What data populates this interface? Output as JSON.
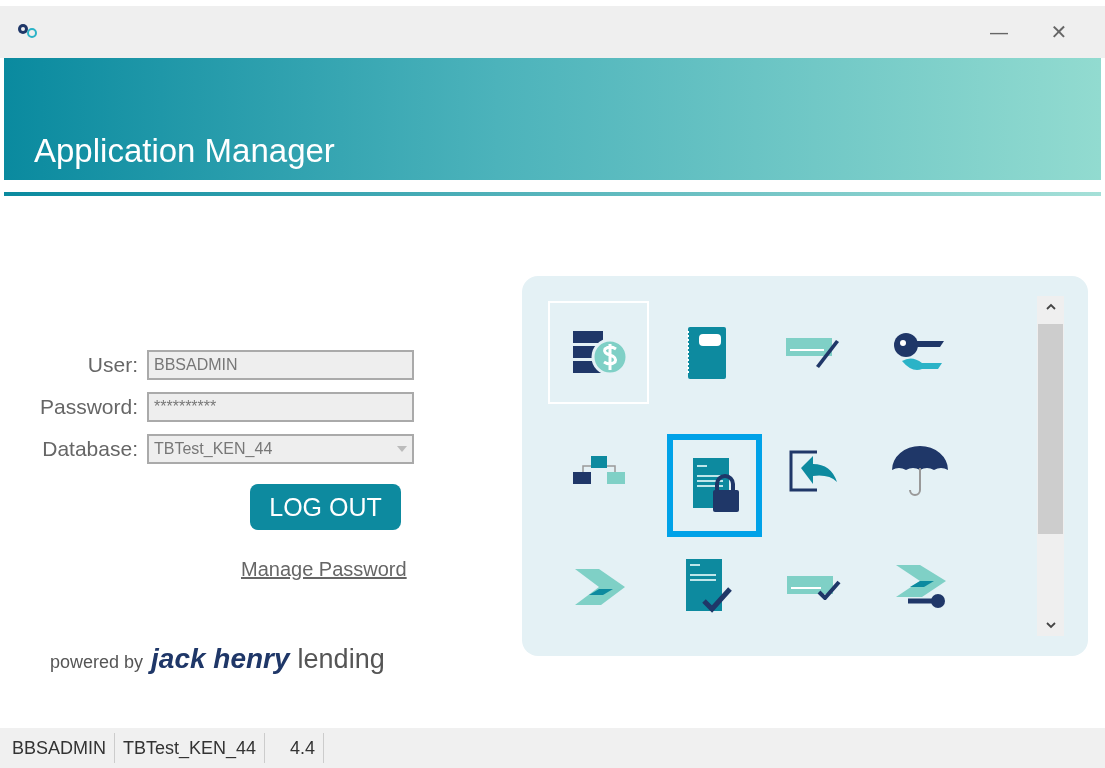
{
  "window": {
    "title": "Application Manager",
    "controls": [
      "—",
      "✕"
    ]
  },
  "login": {
    "fields": [
      {
        "label": "User:",
        "value": "BBSADMIN",
        "kind": "text"
      },
      {
        "label": "Password:",
        "value": "**********",
        "kind": "text"
      },
      {
        "label": "Database:",
        "value": "TBTest_KEN_44",
        "kind": "dropdown"
      }
    ],
    "button": "LOG OUT",
    "link": "Manage Password"
  },
  "branding": {
    "prefix": "powered by",
    "brand": "jack henry",
    "suffix": "lending"
  },
  "apps": [
    {
      "kind": "ledger",
      "selected": false,
      "focused": true
    },
    {
      "kind": "notebook",
      "selected": false,
      "focused": false
    },
    {
      "kind": "check-pen",
      "selected": false,
      "focused": false
    },
    {
      "kind": "keys",
      "selected": false,
      "focused": false
    },
    {
      "kind": "hierarchy",
      "selected": false,
      "focused": false
    },
    {
      "kind": "doc-lock",
      "selected": true,
      "focused": false
    },
    {
      "kind": "import",
      "selected": false,
      "focused": false
    },
    {
      "kind": "umbrella",
      "selected": false,
      "focused": false
    },
    {
      "kind": "scanner",
      "selected": false,
      "focused": false
    },
    {
      "kind": "doc-check",
      "selected": false,
      "focused": false
    },
    {
      "kind": "check-tick",
      "selected": false,
      "focused": false
    },
    {
      "kind": "scanner-key",
      "selected": false,
      "focused": false
    }
  ],
  "status_bar": [
    "BBSADMIN",
    "TBTest_KEN_44",
    "4.4"
  ]
}
